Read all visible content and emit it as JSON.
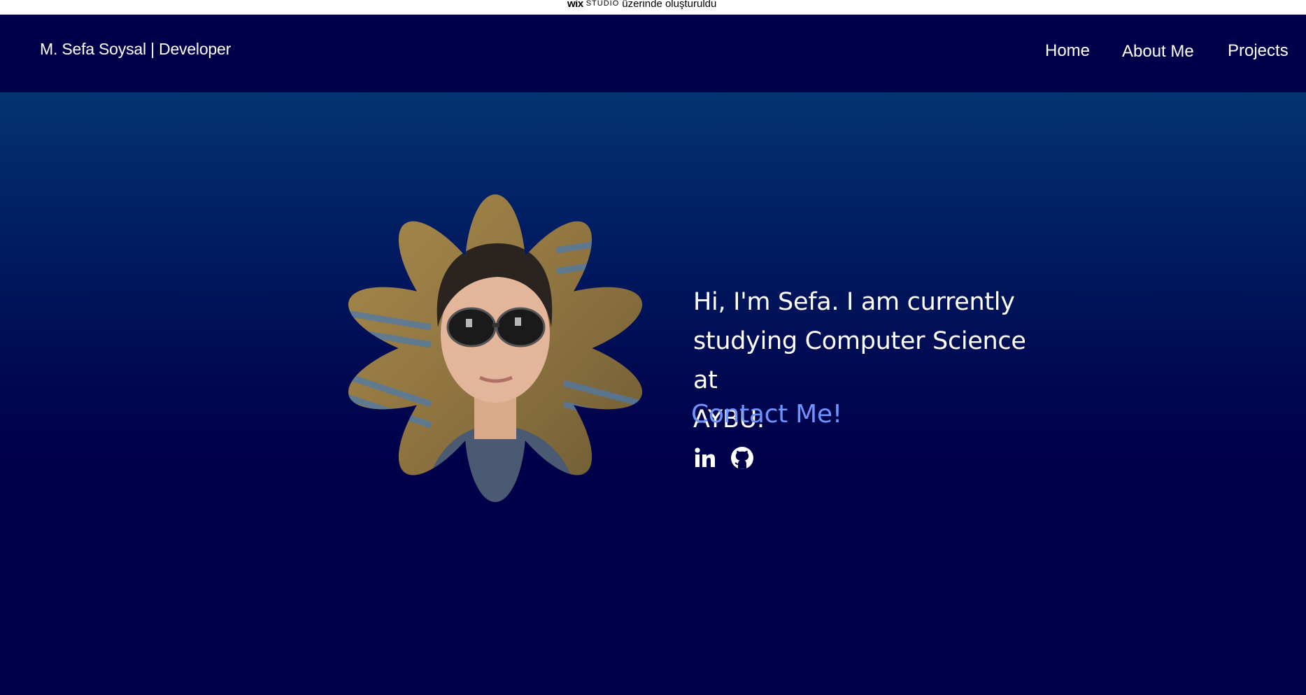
{
  "topbar": {
    "logo": "wix",
    "product": "STUDIO",
    "text": "üzerinde oluşturuldu"
  },
  "header": {
    "brand": "M. Sefa Soysal | Developer",
    "nav": [
      {
        "label": "Home"
      },
      {
        "label": "About Me"
      },
      {
        "label": "Projects"
      }
    ]
  },
  "hero": {
    "intro_lines": [
      "Hi, I'm Sefa. I am currently",
      "studying Computer Science at",
      "AYBU."
    ],
    "contact_label": "Contact Me!",
    "socials": [
      {
        "icon": "linkedin-icon"
      },
      {
        "icon": "github-icon"
      }
    ],
    "photo_shape": "flower"
  },
  "colors": {
    "header_bg": "#00004a",
    "hero_gradient_top": "#023473",
    "hero_gradient_bottom": "#00004a",
    "contact_link": "#6f93ff",
    "text": "#ffffff"
  }
}
